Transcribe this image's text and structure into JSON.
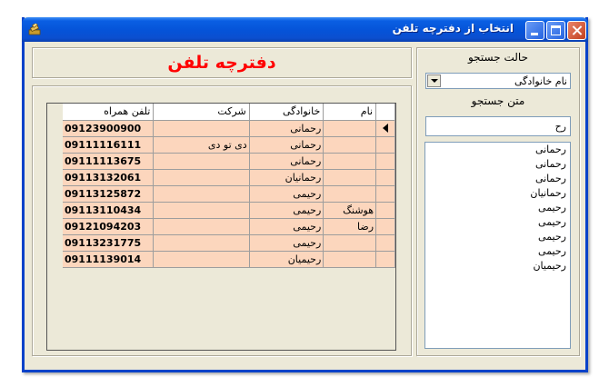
{
  "window": {
    "title": "انتخاب از دفترچه تلفن"
  },
  "header": {
    "title": "دفترچه تلفن",
    "title_color": "#ff0000"
  },
  "search": {
    "mode_label": "حالت جستجو",
    "mode_value": "نام خانوادگی",
    "text_label": "متن جستجو",
    "text_value": "رح",
    "results": [
      "رحمانی",
      "رحمانی",
      "رحمانی",
      "رحمانیان",
      "رحیمی",
      "رحیمی",
      "رحیمی",
      "رحیمی",
      "رحیمیان"
    ]
  },
  "grid": {
    "columns": {
      "name": "نام",
      "family": "خانوادگی",
      "company": "شرکت",
      "phone": "تلفن همراه"
    },
    "rows": [
      {
        "name": "",
        "family": "رحمانی",
        "company": "",
        "phone": "09123900900"
      },
      {
        "name": "",
        "family": "رحمانی",
        "company": "دی تو دی",
        "phone": "09111116111"
      },
      {
        "name": "",
        "family": "رحمانی",
        "company": "",
        "phone": "09111113675"
      },
      {
        "name": "",
        "family": "رحمانیان",
        "company": "",
        "phone": "09113132061"
      },
      {
        "name": "",
        "family": "رحیمی",
        "company": "",
        "phone": "09113125872"
      },
      {
        "name": "هوشنگ",
        "family": "رحیمی",
        "company": "",
        "phone": "09113110434"
      },
      {
        "name": "رضا",
        "family": "رحیمی",
        "company": "",
        "phone": "09121094203"
      },
      {
        "name": "",
        "family": "رحیمی",
        "company": "",
        "phone": "09113231775"
      },
      {
        "name": "",
        "family": "رحیمیان",
        "company": "",
        "phone": "09111139014"
      }
    ]
  },
  "colors": {
    "title_bar": "#0553d8",
    "row_background": "#fcd6bd",
    "window_background": "#ece9d8"
  }
}
